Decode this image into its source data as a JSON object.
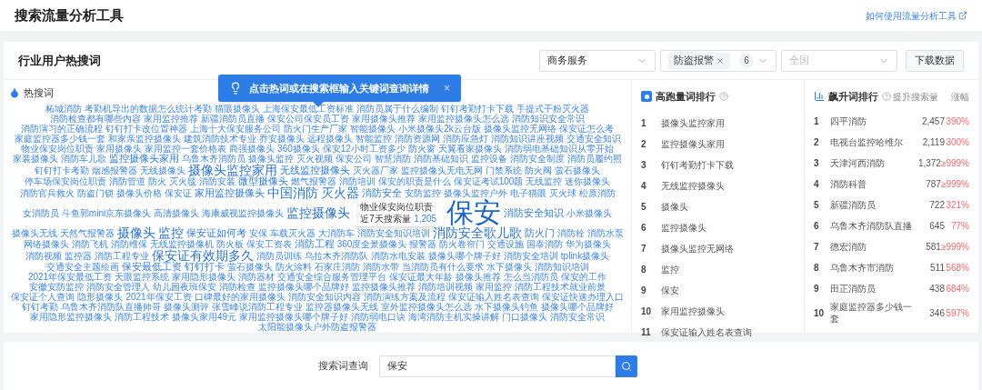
{
  "header": {
    "title": "搜索流量分析工具",
    "help_link": "如何使用流量分析工具"
  },
  "panel": {
    "title": "行业用户热搜词",
    "filters": [
      {
        "kind": "select",
        "value": "商务服务"
      },
      {
        "kind": "tags",
        "tag": "防盗报警",
        "count": "6"
      },
      {
        "kind": "select",
        "placeholder": "全国"
      }
    ],
    "download_button": "下载数据"
  },
  "hint": {
    "text": "点击热词或在搜索框输入关键词查询详情",
    "close": "×"
  },
  "word_cloud": {
    "title": "热搜词",
    "tooltip": {
      "word": "物业保安岗位职责",
      "label": "近7天搜索量",
      "value": "1,205"
    },
    "words": [
      {
        "text": "柘城消防",
        "kind": "s"
      },
      {
        "text": "考勤机导出的数据怎么统计考勤",
        "kind": "s"
      },
      {
        "text": "猫眼摄像头",
        "kind": "s"
      },
      {
        "text": "上海保安最低工资标准",
        "kind": "s"
      },
      {
        "text": "消防员属于什么编制",
        "kind": "s"
      },
      {
        "text": "钉钉考勤打卡下载",
        "kind": "s"
      },
      {
        "text": "手提式干粉灭火器",
        "kind": "s"
      },
      {
        "text": "消防检查都有哪些内容",
        "kind": "s"
      },
      {
        "text": "家用监控推荐",
        "kind": "s"
      },
      {
        "text": "新疆消防员直播",
        "kind": "s"
      },
      {
        "text": "保安公司保安员工资",
        "kind": "s"
      },
      {
        "text": "家用摄像头推荐",
        "kind": "s"
      },
      {
        "text": "家用监控摄像头怎么选",
        "kind": "s"
      },
      {
        "text": "消防知识安全常识",
        "kind": "s"
      },
      {
        "text": "消防演习的正确流程",
        "kind": "s"
      },
      {
        "text": "钉钉打卡改位置神器",
        "kind": "s"
      },
      {
        "text": "上海十大保安服务公司",
        "kind": "s"
      },
      {
        "text": "防火门生产厂家",
        "kind": "s"
      },
      {
        "text": "智能摄像头",
        "kind": "s"
      },
      {
        "text": "小米摄像头2k云台版",
        "kind": "s"
      },
      {
        "text": "摄像头监控无网络",
        "kind": "s"
      },
      {
        "text": "保安证怎么考",
        "kind": "s"
      },
      {
        "text": "家庭监控器多少钱一套",
        "kind": "s"
      },
      {
        "text": "和家亲监控摄像头",
        "kind": "s"
      },
      {
        "text": "建筑消防技术专业",
        "kind": "s"
      },
      {
        "text": "乔安摄像头",
        "kind": "s"
      },
      {
        "text": "远程摄像头",
        "kind": "s"
      },
      {
        "text": "智能监控",
        "kind": "s"
      },
      {
        "text": "消防资源网",
        "kind": "s"
      },
      {
        "text": "消防应急灯",
        "kind": "s"
      },
      {
        "text": "消防知识讲座视频",
        "kind": "s"
      },
      {
        "text": "交通安全知识",
        "kind": "s"
      },
      {
        "text": "物业保安岗位职责",
        "kind": "s"
      },
      {
        "text": "家用摄像头",
        "kind": "s"
      },
      {
        "text": "家用监控一套价格表",
        "kind": "s"
      },
      {
        "text": "商强摄像头",
        "kind": "s"
      },
      {
        "text": "360摄像头",
        "kind": "s"
      },
      {
        "text": "保安12小时工资多少",
        "kind": "s"
      },
      {
        "text": "防火窗",
        "kind": "s"
      },
      {
        "text": "天翼看家摄像头",
        "kind": "s"
      },
      {
        "text": "消防弱电基础知识从零开始",
        "kind": "s"
      },
      {
        "text": "家装摄像头",
        "kind": "s"
      },
      {
        "text": "消防车儿歌",
        "kind": "s"
      },
      {
        "text": "监控摄像头家用",
        "kind": "m"
      },
      {
        "text": "乌鲁木齐消防员",
        "kind": "s"
      },
      {
        "text": "摄像头监控",
        "kind": "s"
      },
      {
        "text": "灭火视频",
        "kind": "s"
      },
      {
        "text": "保安公司",
        "kind": "s"
      },
      {
        "text": "智慧消防",
        "kind": "s"
      },
      {
        "text": "消防基础知识",
        "kind": "s"
      },
      {
        "text": "监控设备",
        "kind": "s"
      },
      {
        "text": "消防安全制度",
        "kind": "s"
      },
      {
        "text": "消防员履约照",
        "kind": "s"
      },
      {
        "text": "钉钉打卡考勤",
        "kind": "s"
      },
      {
        "text": "烟感报警器",
        "kind": "s"
      },
      {
        "text": "无线摄像头",
        "kind": "s"
      },
      {
        "text": "摄像头监控家用",
        "kind": "l"
      },
      {
        "text": "无线监控摄像头",
        "kind": "m"
      },
      {
        "text": "灭火器厂家",
        "kind": "s"
      },
      {
        "text": "监控摄像头无电无网",
        "kind": "s"
      },
      {
        "text": "门禁系统",
        "kind": "s"
      },
      {
        "text": "防火阀",
        "kind": "s"
      },
      {
        "text": "萤石摄像头",
        "kind": "s"
      },
      {
        "text": "停车场保安岗位职责",
        "kind": "s"
      },
      {
        "text": "消防管道",
        "kind": "s"
      },
      {
        "text": "防火",
        "kind": "s"
      },
      {
        "text": "灭火毯",
        "kind": "s"
      },
      {
        "text": "消防安装",
        "kind": "s"
      },
      {
        "text": "微型摄像头",
        "kind": "m"
      },
      {
        "text": "燃气报警器",
        "kind": "s"
      },
      {
        "text": "消防培训",
        "kind": "s"
      },
      {
        "text": "保安的职责是什么",
        "kind": "s"
      },
      {
        "text": "保安证考试100题",
        "kind": "s"
      },
      {
        "text": "无线监控",
        "kind": "s"
      },
      {
        "text": "迷你摄像头",
        "kind": "s"
      },
      {
        "text": "消防官兵救火",
        "kind": "s"
      },
      {
        "text": "防盗门锁",
        "kind": "s"
      },
      {
        "text": "摄像头价格",
        "kind": "s"
      },
      {
        "text": "保安证",
        "kind": "s"
      },
      {
        "text": "家用监控摄像头",
        "kind": "m"
      },
      {
        "text": "中国消防",
        "kind": "l"
      },
      {
        "text": "灭火器",
        "kind": "l"
      },
      {
        "text": "消防安全",
        "kind": "m"
      },
      {
        "text": "安防监控",
        "kind": "s"
      },
      {
        "text": "摄像头监控户外",
        "kind": "s"
      },
      {
        "text": "电子猫眼",
        "kind": "s"
      },
      {
        "text": "灭火球",
        "kind": "s"
      },
      {
        "text": "松原消防",
        "kind": "s"
      },
      {
        "text": "女消防员",
        "kind": "s"
      },
      {
        "text": "斗鱼郭mini京东摄像头",
        "kind": "s"
      },
      {
        "text": "高清摄像头",
        "kind": "s"
      },
      {
        "text": "海康威视监控摄像头",
        "kind": "s"
      },
      {
        "text": "监控摄像头",
        "kind": "l"
      },
      {
        "text": "保安",
        "kind": "xl"
      },
      {
        "text": "消防安全知识",
        "kind": "m"
      },
      {
        "text": "小米摄像头",
        "kind": "s"
      },
      {
        "text": "摄像头无线",
        "kind": "s"
      },
      {
        "text": "天然气报警器",
        "kind": "s"
      },
      {
        "text": "摄像头",
        "kind": "l"
      },
      {
        "text": "监控",
        "kind": "l"
      },
      {
        "text": "保安证如何考",
        "kind": "m"
      },
      {
        "text": "安保",
        "kind": "s"
      },
      {
        "text": "车载灭火器",
        "kind": "s"
      },
      {
        "text": "大消防车",
        "kind": "s"
      },
      {
        "text": "消防安全知识培训",
        "kind": "s"
      },
      {
        "text": "消防安全歌儿歌",
        "kind": "l"
      },
      {
        "text": "防火门",
        "kind": "m"
      },
      {
        "text": "消防栓",
        "kind": "s"
      },
      {
        "text": "消防水泵",
        "kind": "s"
      },
      {
        "text": "网络摄像头",
        "kind": "s"
      },
      {
        "text": "消防飞机",
        "kind": "s"
      },
      {
        "text": "消防维保",
        "kind": "s"
      },
      {
        "text": "无线监控摄像机",
        "kind": "s"
      },
      {
        "text": "防火板",
        "kind": "s"
      },
      {
        "text": "保安工资表",
        "kind": "s"
      },
      {
        "text": "消防工程",
        "kind": "m"
      },
      {
        "text": "360度全景摄像头",
        "kind": "s"
      },
      {
        "text": "报警器",
        "kind": "s"
      },
      {
        "text": "防火卷帘门",
        "kind": "s"
      },
      {
        "text": "交通设施",
        "kind": "s"
      },
      {
        "text": "国泰消防",
        "kind": "s"
      },
      {
        "text": "华为摄像头",
        "kind": "s"
      },
      {
        "text": "消防视频",
        "kind": "s"
      },
      {
        "text": "监控器",
        "kind": "s"
      },
      {
        "text": "消防工程专业",
        "kind": "s"
      },
      {
        "text": "保安证有效期多久",
        "kind": "l"
      },
      {
        "text": "消防员训练",
        "kind": "s"
      },
      {
        "text": "乌拉木齐消防队",
        "kind": "s"
      },
      {
        "text": "消防水电安装",
        "kind": "s"
      },
      {
        "text": "摄像头哪个牌子好",
        "kind": "s"
      },
      {
        "text": "消防安全培训",
        "kind": "s"
      },
      {
        "text": "tplink摄像头",
        "kind": "s"
      },
      {
        "text": "交通安全主题绘画",
        "kind": "s"
      },
      {
        "text": "保安最低工资",
        "kind": "m"
      },
      {
        "text": "钉钉打卡",
        "kind": "m"
      },
      {
        "text": "萤石摄像头",
        "kind": "s"
      },
      {
        "text": "防火涂料",
        "kind": "s"
      },
      {
        "text": "石家庄消防",
        "kind": "s"
      },
      {
        "text": "消防水带",
        "kind": "s"
      },
      {
        "text": "当消防员有什么要求",
        "kind": "s"
      },
      {
        "text": "水下摄像头",
        "kind": "s"
      },
      {
        "text": "消防知识培训",
        "kind": "s"
      },
      {
        "text": "2021年保安最低工资",
        "kind": "s"
      },
      {
        "text": "天眼监控系统",
        "kind": "s"
      },
      {
        "text": "家用隐形摄像头",
        "kind": "s"
      },
      {
        "text": "消防器材",
        "kind": "s"
      },
      {
        "text": "交通安全综合服务管理平台",
        "kind": "s"
      },
      {
        "text": "保安证最大年龄",
        "kind": "s"
      },
      {
        "text": "摄像头推荐",
        "kind": "s"
      },
      {
        "text": "怎么当消防员",
        "kind": "s"
      },
      {
        "text": "保安的工作",
        "kind": "s"
      },
      {
        "text": "安徽安防监控",
        "kind": "s"
      },
      {
        "text": "消防安全管理人",
        "kind": "s"
      },
      {
        "text": "幼儿园夜班保安",
        "kind": "s"
      },
      {
        "text": "消防检查",
        "kind": "s"
      },
      {
        "text": "监控摄像头哪个品牌好",
        "kind": "s"
      },
      {
        "text": "监控摄像头推荐",
        "kind": "s"
      },
      {
        "text": "消防培训视频",
        "kind": "s"
      },
      {
        "text": "家用监控",
        "kind": "s"
      },
      {
        "text": "消防工程技术就业前景",
        "kind": "s"
      },
      {
        "text": "保安证个人查询",
        "kind": "s"
      },
      {
        "text": "隐形摄像头",
        "kind": "s"
      },
      {
        "text": "2021年保安工资",
        "kind": "s"
      },
      {
        "text": "口碑最好的家用摄像头",
        "kind": "s"
      },
      {
        "text": "消防安全知识内容",
        "kind": "s"
      },
      {
        "text": "消防演练方案及流程",
        "kind": "s"
      },
      {
        "text": "保安证输入姓名表查询",
        "kind": "s"
      },
      {
        "text": "保安证快速办理入口",
        "kind": "s"
      },
      {
        "text": "钉钉考勤",
        "kind": "s"
      },
      {
        "text": "乌鲁木齐消防队直播帅哥",
        "kind": "s"
      },
      {
        "text": "摄像头测评",
        "kind": "s"
      },
      {
        "text": "张雪峰说消防工程专业",
        "kind": "s"
      },
      {
        "text": "监控器摄像头无线",
        "kind": "s"
      },
      {
        "text": "室外监控摄像头怎么选",
        "kind": "s"
      },
      {
        "text": "水下摄像头钓鱼",
        "kind": "s"
      },
      {
        "text": "摄像头哪个品牌好",
        "kind": "s"
      },
      {
        "text": "家用隐形监控摄像头",
        "kind": "s"
      },
      {
        "text": "消防工程技术",
        "kind": "s"
      },
      {
        "text": "摄像头家用49元",
        "kind": "s"
      },
      {
        "text": "家用监控摄像头哪个牌子好",
        "kind": "s"
      },
      {
        "text": "消防弱电口诀",
        "kind": "s"
      },
      {
        "text": "海湾消防主机实操讲解",
        "kind": "s"
      },
      {
        "text": "门口摄像头",
        "kind": "s"
      },
      {
        "text": "消防安全常识",
        "kind": "s"
      },
      {
        "text": "太阳能摄像头户外防盗报警器",
        "kind": "s"
      }
    ]
  },
  "high_volume_ranking": {
    "title": "高跑量词排行",
    "rows": [
      {
        "rank": "1",
        "word": "摄像头监控家用"
      },
      {
        "rank": "2",
        "word": "监控摄像头家用"
      },
      {
        "rank": "3",
        "word": "钉钉考勤打卡下载"
      },
      {
        "rank": "4",
        "word": "无线监控摄像头"
      },
      {
        "rank": "5",
        "word": "摄像头"
      },
      {
        "rank": "6",
        "word": "监控摄像头"
      },
      {
        "rank": "7",
        "word": "摄像头监控无网络"
      },
      {
        "rank": "8",
        "word": "监控"
      },
      {
        "rank": "9",
        "word": "保安"
      },
      {
        "rank": "10",
        "word": "家用监控摄像头"
      },
      {
        "rank": "11",
        "word": "保安证输入姓名表查询"
      }
    ]
  },
  "rising_ranking": {
    "title": "飙升词排行",
    "columns": [
      "提升搜索量",
      "涨幅"
    ],
    "rows": [
      {
        "rank": "1",
        "word": "四平消防",
        "volume": "2,457",
        "growth": "390%"
      },
      {
        "rank": "2",
        "word": "电视台监控哈维尔",
        "volume": "2,119",
        "growth": "300%"
      },
      {
        "rank": "3",
        "word": "天津河西消防",
        "volume": "1,372",
        "growth": "≥999%"
      },
      {
        "rank": "4",
        "word": "消防科普",
        "volume": "787",
        "growth": "≥999%"
      },
      {
        "rank": "5",
        "word": "新疆消防员",
        "volume": "722",
        "growth": "321%"
      },
      {
        "rank": "6",
        "word": "乌鲁木齐消防队直播",
        "volume": "645",
        "growth": "77%"
      },
      {
        "rank": "7",
        "word": "德宏消防",
        "volume": "581",
        "growth": "≥999%"
      },
      {
        "rank": "8",
        "word": "乌鲁木齐市消防",
        "volume": "511",
        "growth": "568%"
      },
      {
        "rank": "9",
        "word": "田正消防员",
        "volume": "438",
        "growth": "684%"
      },
      {
        "rank": "10",
        "word": "家庭监控器多少钱一套",
        "volume": "346",
        "growth": "597%"
      }
    ]
  },
  "search_bar": {
    "label": "搜索词查询",
    "value": "保安"
  }
}
